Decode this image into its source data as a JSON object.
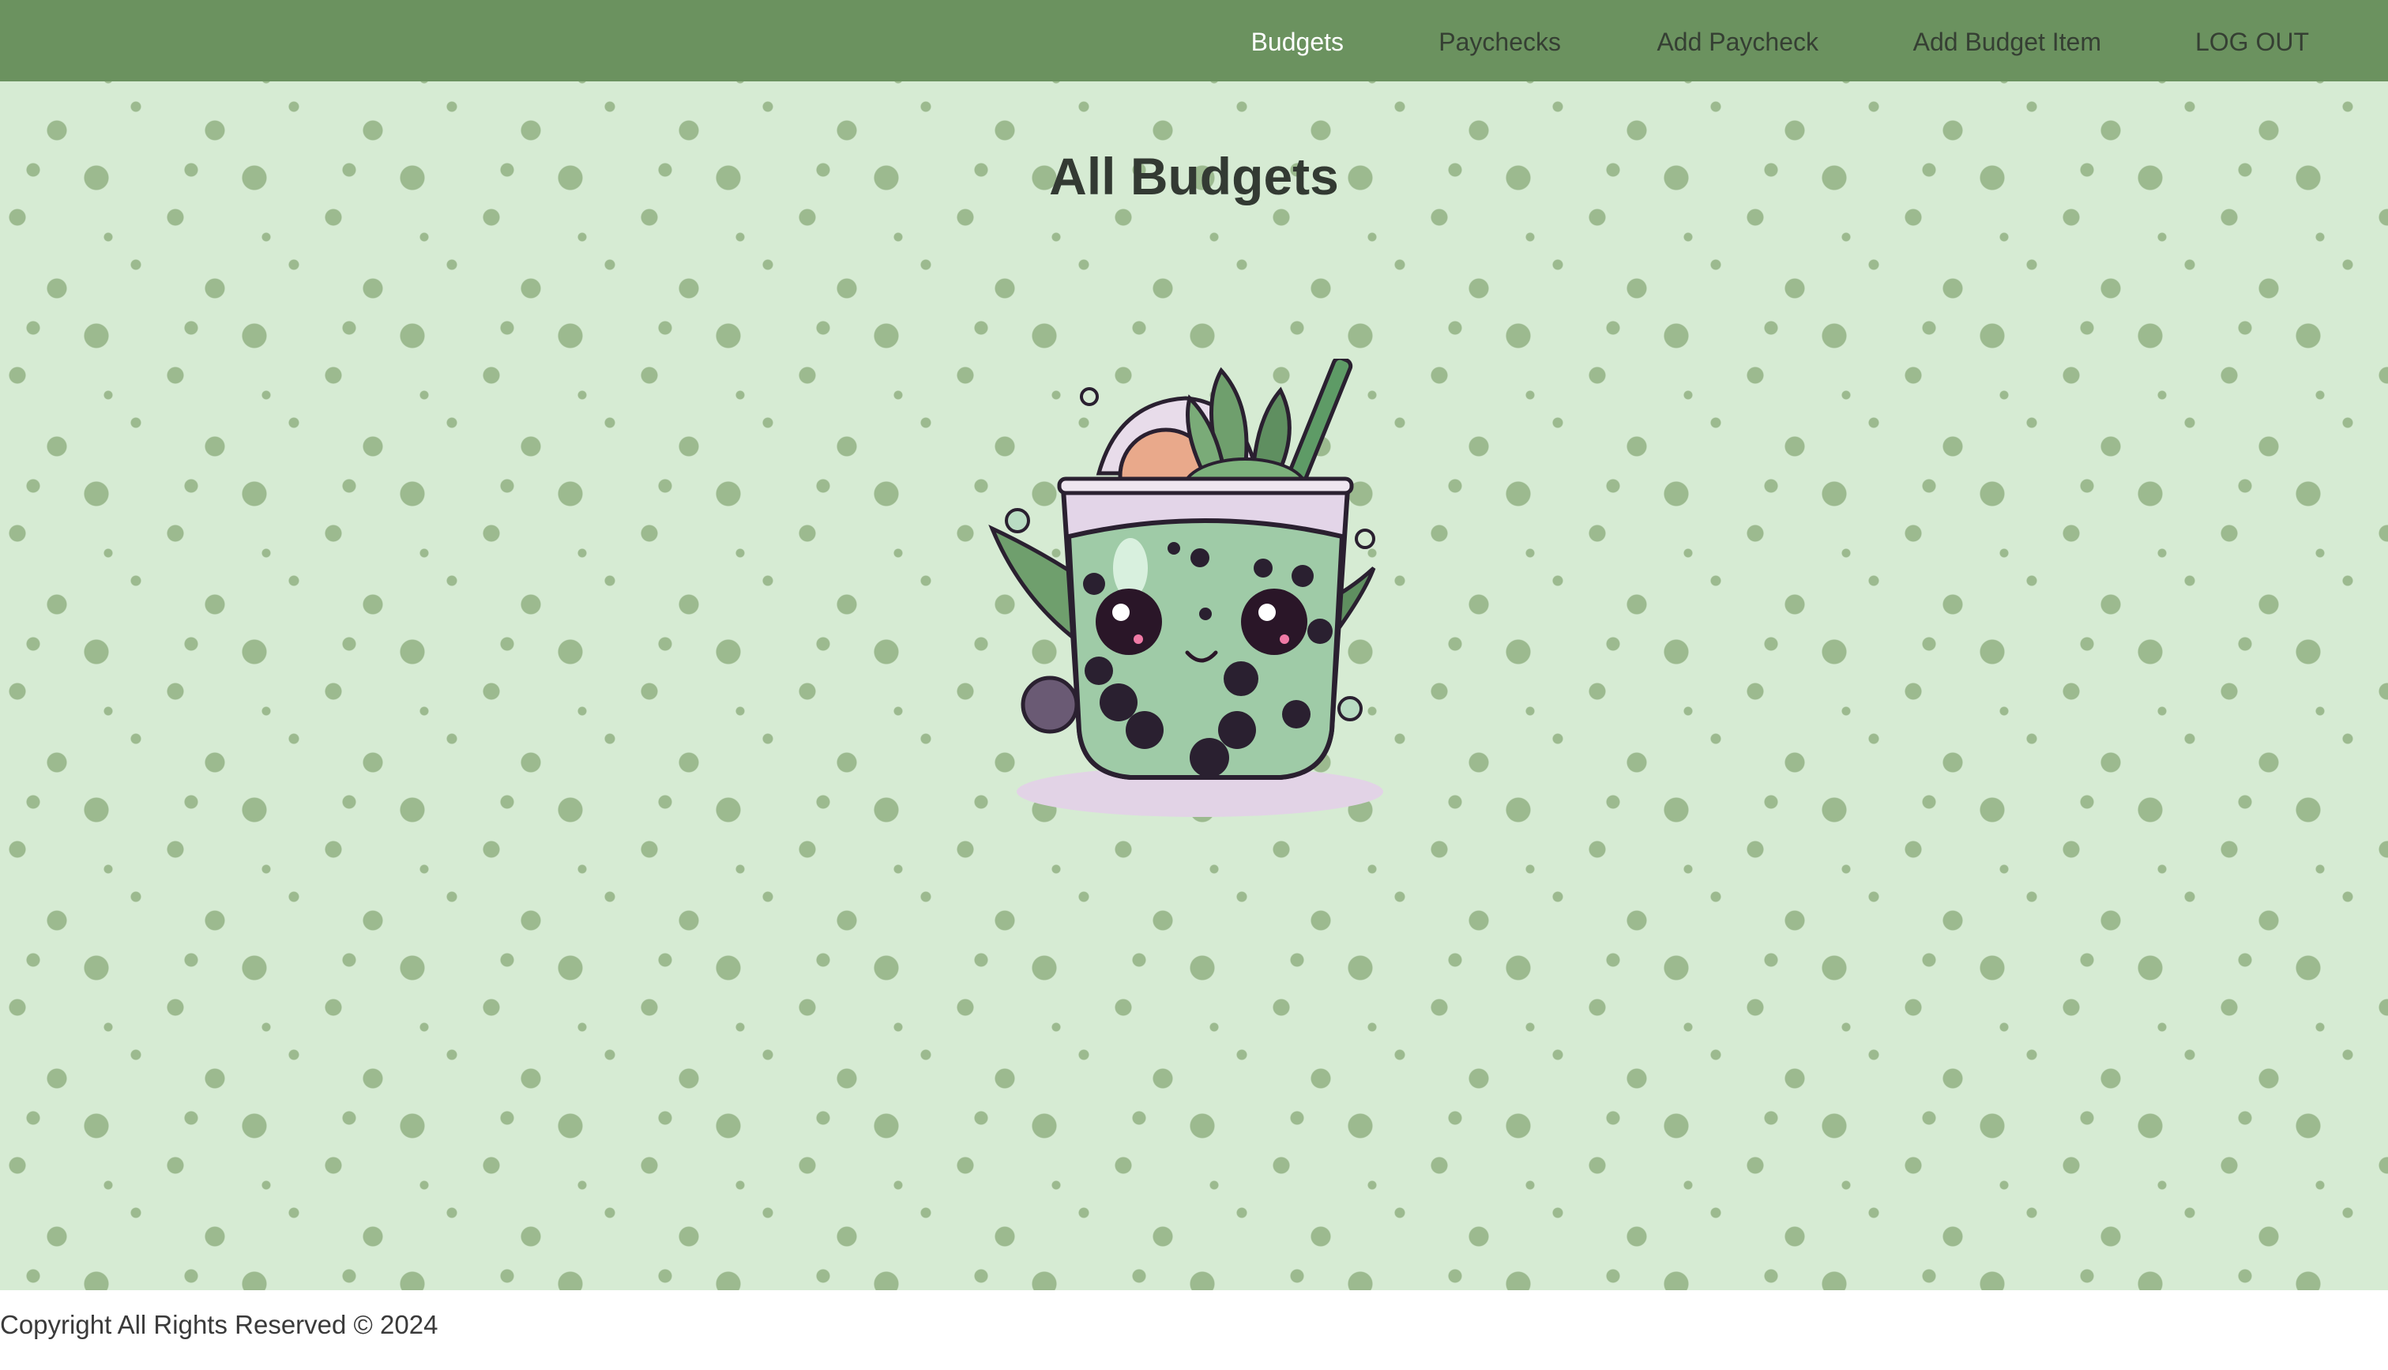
{
  "nav": {
    "items": [
      {
        "label": "Budgets",
        "active": true
      },
      {
        "label": "Paychecks",
        "active": false
      },
      {
        "label": "Add Paycheck",
        "active": false
      },
      {
        "label": "Add Budget Item",
        "active": false
      },
      {
        "label": "LOG OUT",
        "active": false
      }
    ]
  },
  "main": {
    "title": "All Budgets",
    "illustration": "boba-tea-mascot"
  },
  "footer": {
    "text": "Copyright All Rights Reserved © 2024"
  },
  "colors": {
    "navbar": "#6b925f",
    "background": "#d6ebd3",
    "dots": "#9cba8f",
    "nav_active": "#ffffff",
    "nav_text": "#353f33"
  }
}
